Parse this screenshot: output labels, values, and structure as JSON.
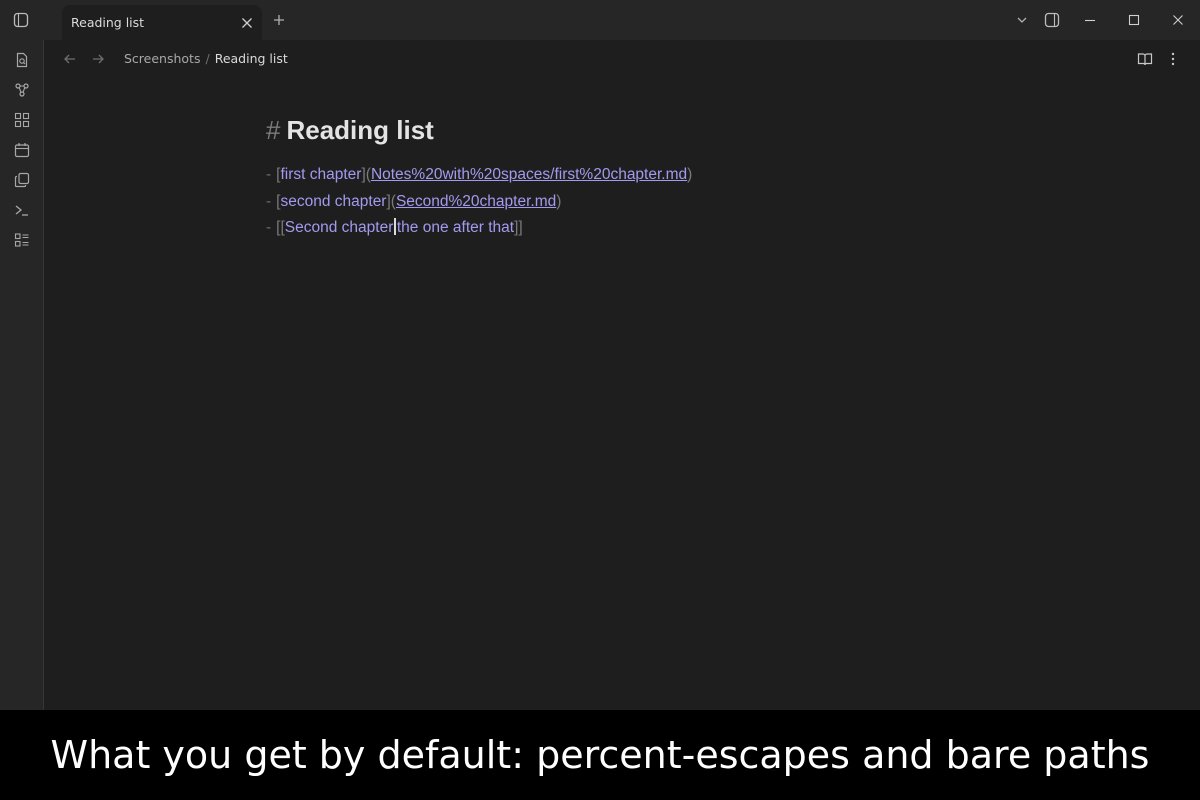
{
  "window": {
    "tab_title": "Reading list"
  },
  "breadcrumb": {
    "parent": "Screenshots",
    "separator": "/",
    "current": "Reading list"
  },
  "note": {
    "heading_marker": "#",
    "heading": "Reading list",
    "list": [
      {
        "bullet": "-",
        "open": "[",
        "text": "first chapter",
        "mid": "](",
        "url": "Notes%20with%20spaces/first%20chapter.md",
        "close": ")"
      },
      {
        "bullet": "-",
        "open": "[",
        "text": "second chapter",
        "mid": "](",
        "url": "Second%20chapter.md",
        "close": ")"
      },
      {
        "bullet": "-",
        "open": "[[",
        "target": "Second chapter",
        "alias_sep": "|",
        "alias": "the one after that",
        "close": "]]"
      }
    ]
  },
  "caption": "What you get by default: percent-escapes and bare paths",
  "colors": {
    "background": "#1e1e1e",
    "chrome": "#262626",
    "link": "#a29aef",
    "caption_bg": "#000000"
  },
  "icons": {
    "ribbon": [
      "file-search-icon",
      "graph-icon",
      "canvas-icon",
      "calendar-icon",
      "copy-icon",
      "terminal-icon",
      "outline-list-icon"
    ],
    "titlebar": [
      "sidebar-left-icon",
      "close-icon",
      "plus-icon",
      "chevron-down-icon",
      "sidebar-right-icon",
      "minimize-icon",
      "maximize-icon",
      "window-close-icon"
    ],
    "navbar": [
      "arrow-left-icon",
      "arrow-right-icon",
      "book-open-icon",
      "more-vertical-icon"
    ]
  }
}
